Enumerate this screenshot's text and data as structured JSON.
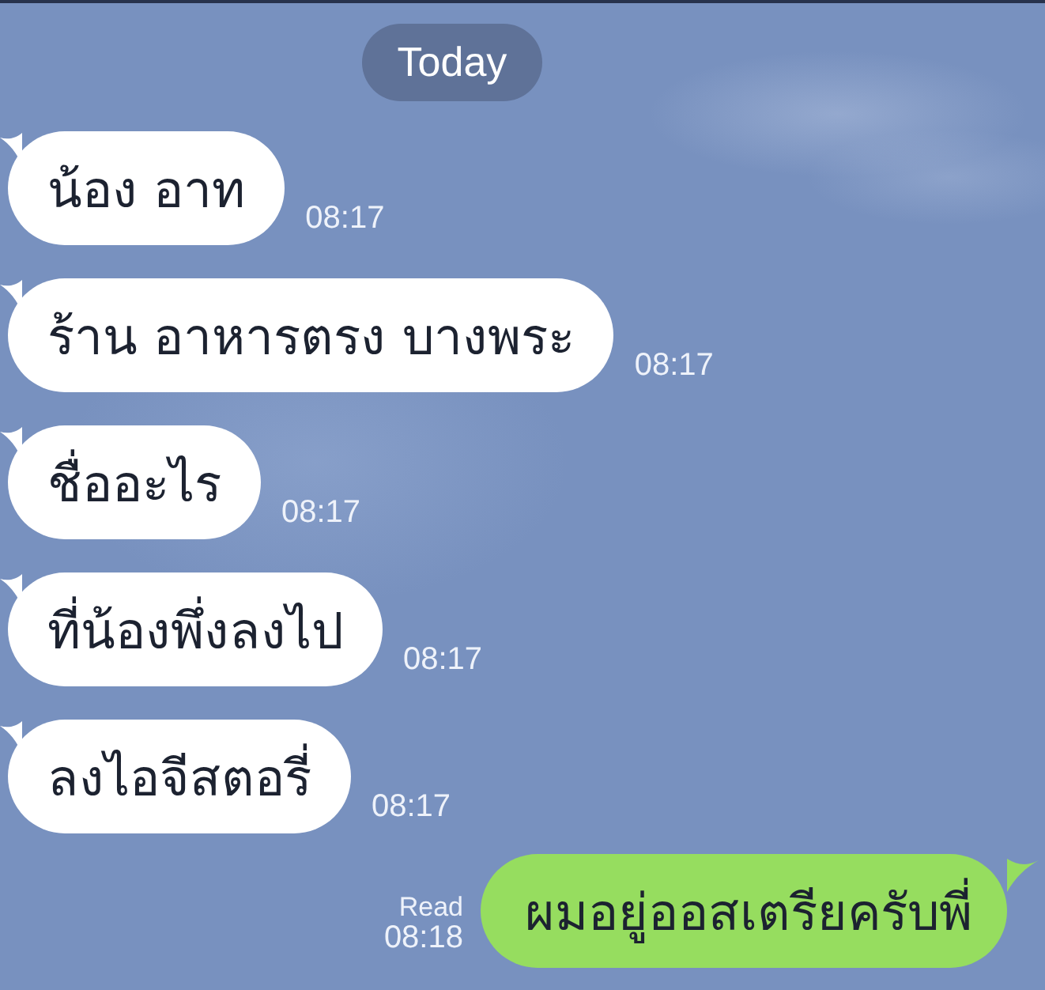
{
  "date_separator": "Today",
  "messages": [
    {
      "kind": "incoming",
      "text": "น้อง อาท",
      "time": "08:17"
    },
    {
      "kind": "incoming",
      "text": "ร้าน อาหารตรง บางพระ",
      "time": "08:17"
    },
    {
      "kind": "incoming",
      "text": "ชื่ออะไร",
      "time": "08:17"
    },
    {
      "kind": "incoming",
      "text": "ที่น้องพึ่งลงไป",
      "time": "08:17"
    },
    {
      "kind": "incoming",
      "text": "ลงไอจีสตอรี่",
      "time": "08:17"
    },
    {
      "kind": "outgoing",
      "text": "ผมอยู่ออสเตรียครับพี่",
      "time": "08:18",
      "read_label": "Read"
    }
  ]
}
